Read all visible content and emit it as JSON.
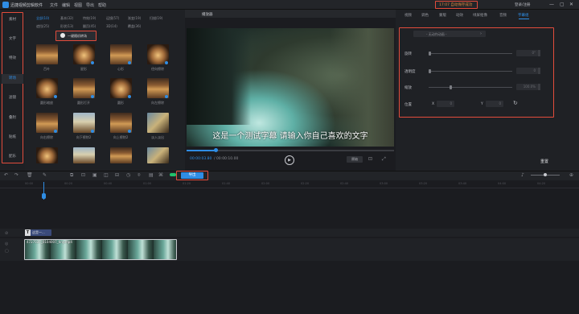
{
  "titlebar": {
    "app_title": "迅捷视频剪辑软件",
    "menus": [
      "文件",
      "编辑",
      "视图",
      "导出",
      "帮助"
    ],
    "status_text": "17:07 自动保存成功",
    "login": "登录/注册",
    "window_buttons": [
      "—",
      "▢",
      "✕"
    ]
  },
  "sidebar": {
    "items": [
      {
        "label": "素材"
      },
      {
        "label": "文字"
      },
      {
        "label": "特效"
      },
      {
        "label": "转场"
      },
      {
        "label": "滤镜"
      },
      {
        "label": "叠附"
      },
      {
        "label": "贴纸"
      },
      {
        "label": "配乐"
      }
    ],
    "active_index": 3
  },
  "library": {
    "tabs_row1": [
      "全部(10)",
      "基本(32)",
      "特效(19)",
      "运镜(57)",
      "渐变(19)",
      "扫描(19)"
    ],
    "tabs_row2": [
      "遮挡(25)",
      "形状(13)",
      "翻页(45)",
      "3D(14)",
      "覆盖(36)"
    ],
    "apply_all": "一键随机转场",
    "thumbnails": [
      {
        "label": "百叶"
      },
      {
        "label": "星形"
      },
      {
        "label": "心形"
      },
      {
        "label": "径向擦除"
      },
      {
        "label": "圆形缩放"
      },
      {
        "label": "圆形打开"
      },
      {
        "label": "圆形"
      },
      {
        "label": "向左擦除"
      },
      {
        "label": "向右擦除"
      },
      {
        "label": "向下擦除2"
      },
      {
        "label": "向上擦除2"
      },
      {
        "label": "淡入淡出"
      }
    ]
  },
  "preview": {
    "title": "播放器",
    "subtitle": "这是一个测试字幕 请输入你自己喜欢的文字",
    "timecode": "00:00:03.80",
    "timecode_total": "/ 00:00:10.00",
    "progress": 0.14,
    "quality": "原始",
    "play_icon": "▶"
  },
  "right_panel": {
    "tabs": [
      "视频",
      "调色",
      "蒙版",
      "动效",
      "绿屏抠像",
      "音频",
      "字幕组"
    ],
    "active_tab": 6,
    "preset": "- 无动作动画 -",
    "props": [
      {
        "label": "旋转",
        "value": "0°",
        "level": 0.0
      },
      {
        "label": "透明度",
        "value": "0",
        "level": 0.0
      },
      {
        "label": "缩放",
        "value": "100.0%",
        "level": 0.25
      }
    ],
    "position": {
      "label": "位置",
      "x_label": "X",
      "x": "0",
      "y_label": "Y",
      "y": "0"
    },
    "reset": "重置"
  },
  "toolbar": {
    "tools": [
      "↶",
      "↷",
      "🗑",
      "✎",
      "⧉",
      "⊡",
      "▣",
      "◫",
      "⊟",
      "◷",
      "⌾",
      "▤",
      "⌘",
      "♪",
      "⊕"
    ],
    "export": "导出"
  },
  "ruler": {
    "ticks": [
      "00:00",
      "00:20",
      "00:40",
      "01:00",
      "01:20",
      "01:40",
      "02:00",
      "02:20",
      "02:40",
      "03:00",
      "03:20",
      "03:40",
      "04:00",
      "04:20"
    ]
  },
  "tracks": {
    "text_clip": "这是一...",
    "text_clip_icon": "T",
    "video_clip": "4727537_0104007_tiny.mp4"
  },
  "colors": {
    "accent": "#2f8de4",
    "annotation": "#e34c3c",
    "bg": "#1b1c20"
  }
}
